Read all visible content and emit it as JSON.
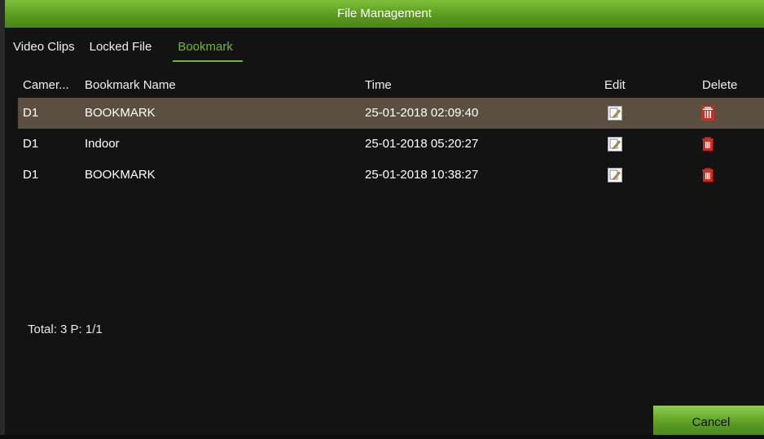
{
  "window": {
    "title": "File Management"
  },
  "tabs": [
    {
      "label": "Video Clips",
      "active": false
    },
    {
      "label": "Locked File",
      "active": false
    },
    {
      "label": "Bookmark",
      "active": true
    }
  ],
  "table": {
    "headers": {
      "camera": "Camer...",
      "name": "Bookmark Name",
      "time": "Time",
      "edit": "Edit",
      "delete": "Delete"
    },
    "rows": [
      {
        "camera": "D1",
        "name": "BOOKMARK",
        "time": "25-01-2018 02:09:40",
        "selected": true
      },
      {
        "camera": "D1",
        "name": "Indoor",
        "time": "25-01-2018 05:20:27",
        "selected": false
      },
      {
        "camera": "D1",
        "name": "BOOKMARK",
        "time": "25-01-2018 10:38:27",
        "selected": false
      }
    ]
  },
  "footer": {
    "summary": "Total: 3 P: 1/1"
  },
  "buttons": {
    "cancel": "Cancel"
  },
  "icons": {
    "edit": "edit-icon",
    "delete": "trash-icon"
  },
  "colors": {
    "accent": "#6fb82b",
    "selected_row": "#5b4f3f",
    "delete_red": "#d42a1e"
  }
}
